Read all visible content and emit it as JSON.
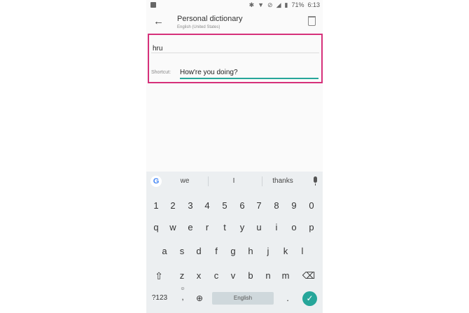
{
  "status_bar": {
    "icons_left": [
      "image-icon"
    ],
    "icons_right": [
      "bluetooth-icon",
      "wifi-icon",
      "mute-icon",
      "signal-icon",
      "battery-icon"
    ],
    "battery_text": "71%",
    "time": "6:13"
  },
  "app_bar": {
    "title": "Personal dictionary",
    "subtitle": "English (United States)",
    "back_icon": "arrow-left-icon",
    "delete_icon": "trash-icon"
  },
  "form": {
    "word_value": "hru",
    "shortcut_label": "Shortcut:",
    "shortcut_value": "How're you doing?"
  },
  "keyboard": {
    "suggestions": [
      "we",
      "I",
      "thanks"
    ],
    "row_numbers": [
      "1",
      "2",
      "3",
      "4",
      "5",
      "6",
      "7",
      "8",
      "9",
      "0"
    ],
    "row_top": [
      "q",
      "w",
      "e",
      "r",
      "t",
      "y",
      "u",
      "i",
      "o",
      "p"
    ],
    "row_mid": [
      "a",
      "s",
      "d",
      "f",
      "g",
      "h",
      "j",
      "k",
      "l"
    ],
    "row_bottom": [
      "z",
      "x",
      "c",
      "v",
      "b",
      "n",
      "m"
    ],
    "symbols_label": "?123",
    "comma": ",",
    "period": ".",
    "space_label": "English",
    "enter_icon": "check-icon",
    "backspace_icon": "backspace-icon",
    "shift_icon": "shift-icon",
    "globe_icon": "globe-icon",
    "emoji_icon": "emoji-icon",
    "mic_icon": "mic-icon",
    "logo": "G"
  },
  "colors": {
    "highlight": "#d6307a",
    "accent": "#26a69a",
    "keyboard_bg": "#eceff1"
  }
}
